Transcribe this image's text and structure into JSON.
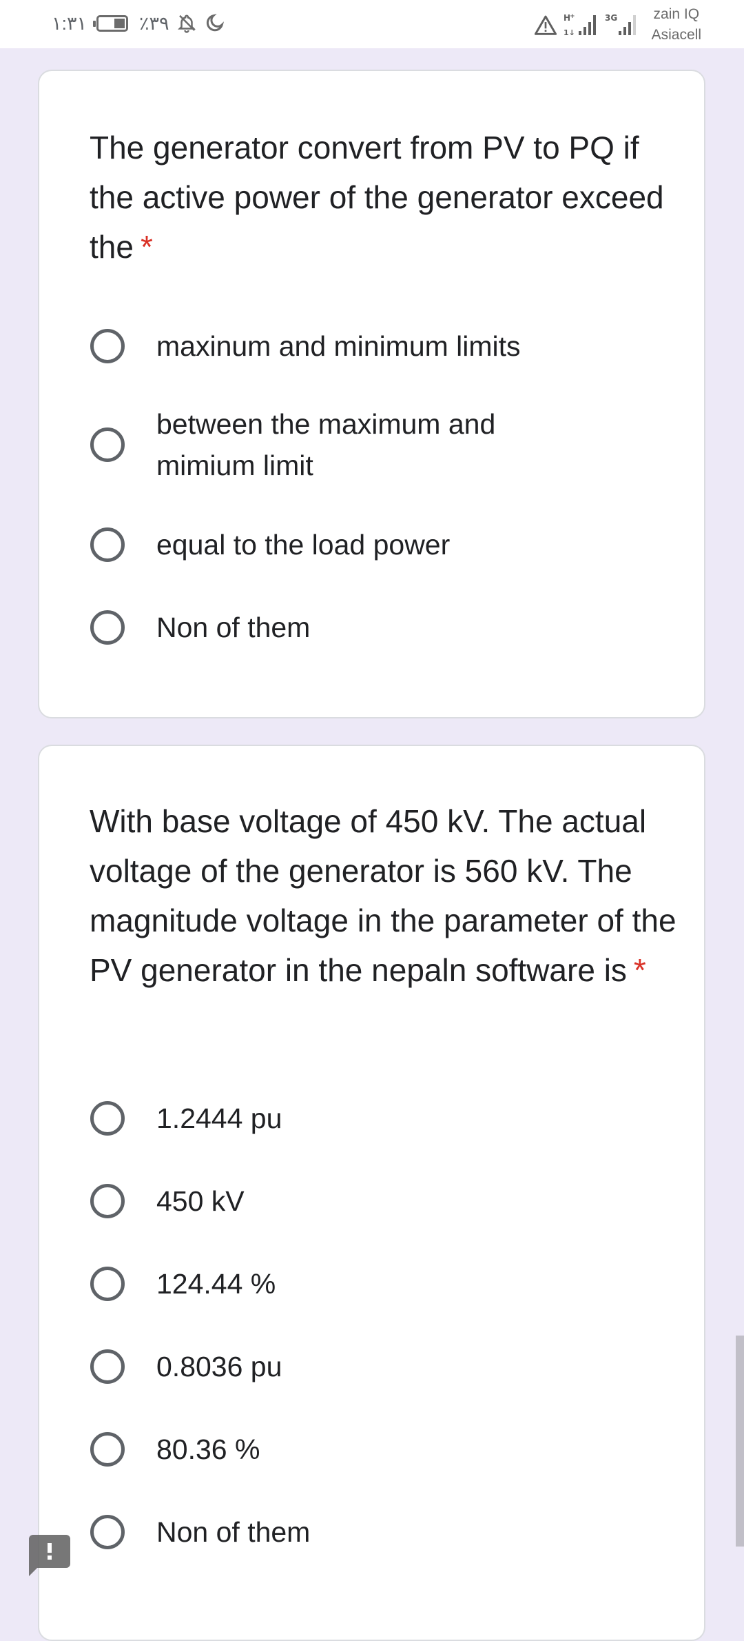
{
  "status_bar": {
    "time": "١:٣١",
    "battery_percent": "٪٣٩",
    "battery_level": 0.39,
    "icons": [
      "battery-icon",
      "bell-off-icon",
      "moon-icon",
      "warning-icon",
      "signal-hplus-icon",
      "signal-3g-icon"
    ],
    "network_1": "H+",
    "network_2": "3G",
    "carrier_1": "zain IQ",
    "carrier_2": "Asiacell"
  },
  "questions": [
    {
      "title": "The generator convert from PV to PQ if the active power of the generator exceed the",
      "required_mark": "*",
      "options": [
        {
          "label": "maxinum and minimum limits",
          "selected": false
        },
        {
          "label": "between the maximum and mimium limit",
          "selected": false
        },
        {
          "label": "equal to the load power",
          "selected": false
        },
        {
          "label": "Non of them",
          "selected": false
        }
      ]
    },
    {
      "title": "With base voltage of 450 kV. The actual voltage of the generator is 560 kV. The magnitude voltage in the parameter of the PV generator in the nepaln software is",
      "required_mark": "*",
      "options": [
        {
          "label": "1.2444 pu",
          "selected": false
        },
        {
          "label": "450 kV",
          "selected": false
        },
        {
          "label": "124.44 %",
          "selected": false
        },
        {
          "label": "0.8036 pu",
          "selected": false
        },
        {
          "label": "80.36 %",
          "selected": false
        },
        {
          "label": "Non of them",
          "selected": false
        }
      ]
    }
  ],
  "feedback_button": {
    "icon": "feedback-icon"
  },
  "colors": {
    "background": "#ede9f7",
    "card": "#ffffff",
    "required": "#d93025",
    "radio": "#5f6368",
    "text": "#202124"
  }
}
